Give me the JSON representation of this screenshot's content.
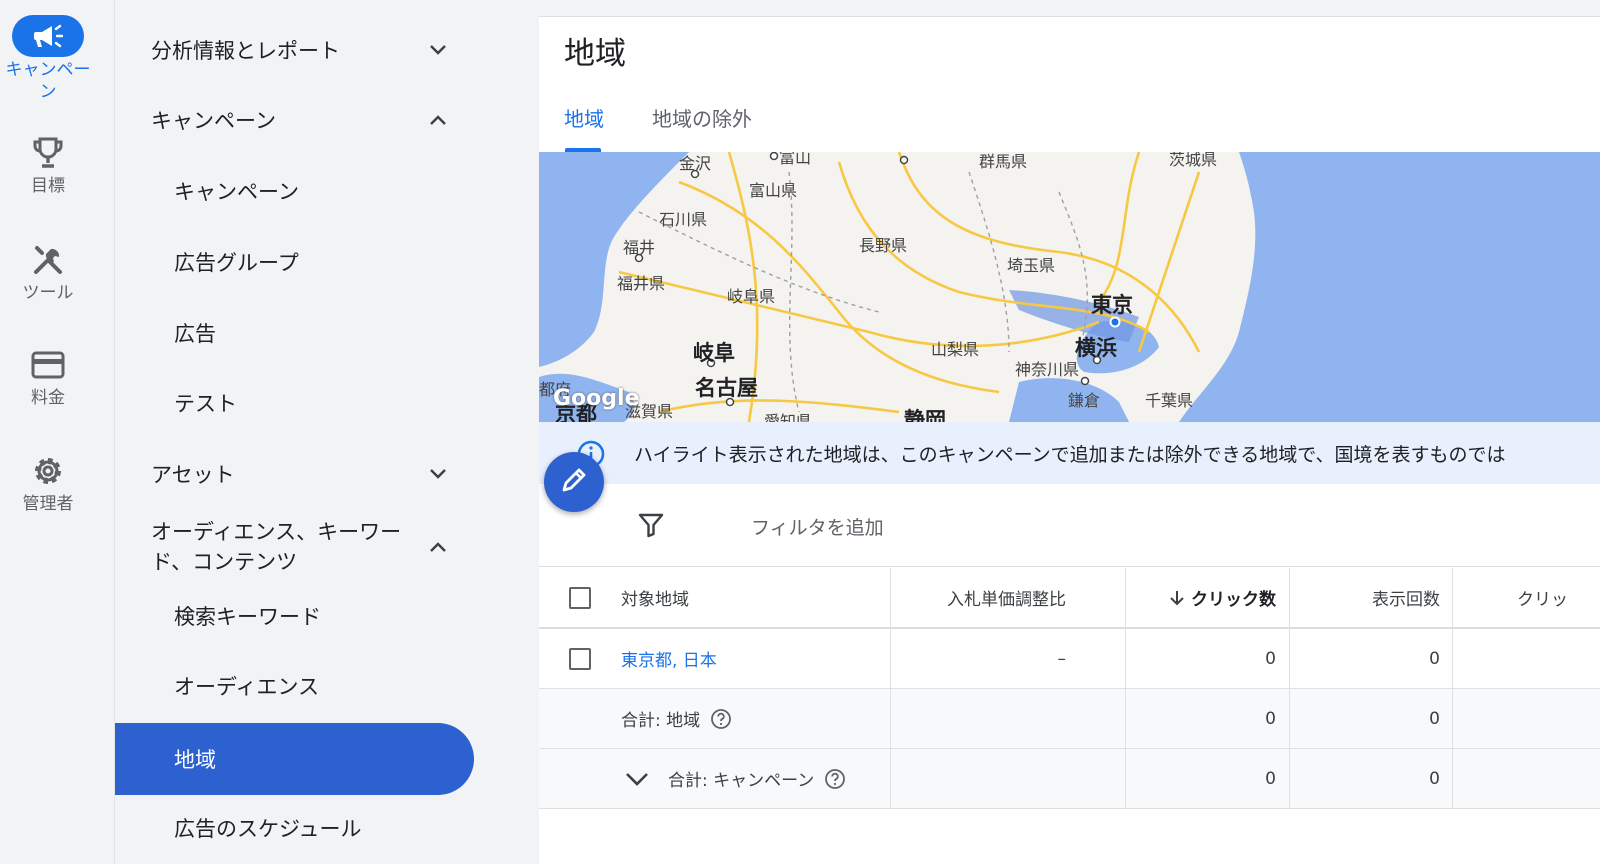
{
  "rail": {
    "items": [
      {
        "label": "キャンペーン",
        "icon": "megaphone-icon"
      },
      {
        "label": "目標",
        "icon": "trophy-icon"
      },
      {
        "label": "ツール",
        "icon": "tools-icon"
      },
      {
        "label": "料金",
        "icon": "credit-card-icon"
      },
      {
        "label": "管理者",
        "icon": "gear-icon"
      }
    ]
  },
  "nav": {
    "items": [
      {
        "label": "分析情報とレポート",
        "chevron": "down"
      },
      {
        "label": "キャンペーン",
        "chevron": "up"
      },
      {
        "label": "キャンペーン"
      },
      {
        "label": "広告グループ"
      },
      {
        "label": "広告"
      },
      {
        "label": "テスト"
      },
      {
        "label": "アセット",
        "chevron": "down"
      },
      {
        "label": "オーディエンス、キーワード、コンテンツ",
        "chevron": "up"
      },
      {
        "label": "検索キーワード"
      },
      {
        "label": "オーディエンス"
      },
      {
        "label": "地域",
        "selected": true
      },
      {
        "label": "広告のスケジュール"
      }
    ]
  },
  "main": {
    "title": "地域",
    "tabs": [
      {
        "label": "地域",
        "active": true
      },
      {
        "label": "地域の除外"
      }
    ],
    "map": {
      "logo": "Google",
      "labels": [
        "金沢",
        "富山",
        "富山県",
        "石川県",
        "福井",
        "福井県",
        "岐阜県",
        "長野県",
        "群馬県",
        "茨城県",
        "埼玉県",
        "東京",
        "横浜",
        "山梨県",
        "神奈川県",
        "鎌倉",
        "千葉県",
        "岐阜",
        "名古屋",
        "京都",
        "静岡",
        "愛知県",
        "滋賀県",
        "都府"
      ]
    },
    "info": "ハイライト表示された地域は、このキャンペーンで追加または除外できる地域で、国境を表すものでは",
    "filter": {
      "label": "フィルタを追加"
    },
    "table": {
      "headers": [
        "対象地域",
        "入札単価調整比",
        "クリック数",
        "表示回数",
        "クリッ"
      ],
      "rows": [
        {
          "location": "東京都, 日本",
          "bid": "–",
          "clicks": "0",
          "impressions": "0"
        }
      ],
      "totals": [
        {
          "label": "合計: 地域",
          "clicks": "0",
          "impressions": "0"
        },
        {
          "label": "合計: キャンペーン",
          "clicks": "0",
          "impressions": "0"
        }
      ]
    }
  },
  "colors": {
    "accent": "#1a73e8",
    "nav_selected": "#2c61cf",
    "sea": "#8fb4f0",
    "road": "#f7c843",
    "info_bg": "#e8f0fe"
  }
}
